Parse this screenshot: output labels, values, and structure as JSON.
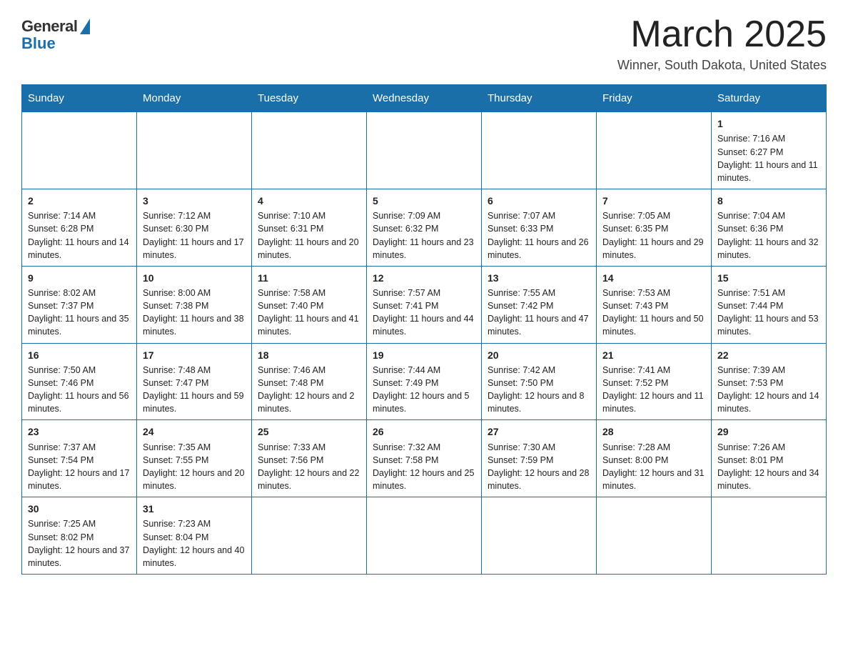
{
  "header": {
    "logo": {
      "general": "General",
      "blue": "Blue"
    },
    "title": "March 2025",
    "location": "Winner, South Dakota, United States"
  },
  "weekdays": [
    "Sunday",
    "Monday",
    "Tuesday",
    "Wednesday",
    "Thursday",
    "Friday",
    "Saturday"
  ],
  "weeks": [
    [
      {
        "day": "",
        "sunrise": "",
        "sunset": "",
        "daylight": ""
      },
      {
        "day": "",
        "sunrise": "",
        "sunset": "",
        "daylight": ""
      },
      {
        "day": "",
        "sunrise": "",
        "sunset": "",
        "daylight": ""
      },
      {
        "day": "",
        "sunrise": "",
        "sunset": "",
        "daylight": ""
      },
      {
        "day": "",
        "sunrise": "",
        "sunset": "",
        "daylight": ""
      },
      {
        "day": "",
        "sunrise": "",
        "sunset": "",
        "daylight": ""
      },
      {
        "day": "1",
        "sunrise": "Sunrise: 7:16 AM",
        "sunset": "Sunset: 6:27 PM",
        "daylight": "Daylight: 11 hours and 11 minutes."
      }
    ],
    [
      {
        "day": "2",
        "sunrise": "Sunrise: 7:14 AM",
        "sunset": "Sunset: 6:28 PM",
        "daylight": "Daylight: 11 hours and 14 minutes."
      },
      {
        "day": "3",
        "sunrise": "Sunrise: 7:12 AM",
        "sunset": "Sunset: 6:30 PM",
        "daylight": "Daylight: 11 hours and 17 minutes."
      },
      {
        "day": "4",
        "sunrise": "Sunrise: 7:10 AM",
        "sunset": "Sunset: 6:31 PM",
        "daylight": "Daylight: 11 hours and 20 minutes."
      },
      {
        "day": "5",
        "sunrise": "Sunrise: 7:09 AM",
        "sunset": "Sunset: 6:32 PM",
        "daylight": "Daylight: 11 hours and 23 minutes."
      },
      {
        "day": "6",
        "sunrise": "Sunrise: 7:07 AM",
        "sunset": "Sunset: 6:33 PM",
        "daylight": "Daylight: 11 hours and 26 minutes."
      },
      {
        "day": "7",
        "sunrise": "Sunrise: 7:05 AM",
        "sunset": "Sunset: 6:35 PM",
        "daylight": "Daylight: 11 hours and 29 minutes."
      },
      {
        "day": "8",
        "sunrise": "Sunrise: 7:04 AM",
        "sunset": "Sunset: 6:36 PM",
        "daylight": "Daylight: 11 hours and 32 minutes."
      }
    ],
    [
      {
        "day": "9",
        "sunrise": "Sunrise: 8:02 AM",
        "sunset": "Sunset: 7:37 PM",
        "daylight": "Daylight: 11 hours and 35 minutes."
      },
      {
        "day": "10",
        "sunrise": "Sunrise: 8:00 AM",
        "sunset": "Sunset: 7:38 PM",
        "daylight": "Daylight: 11 hours and 38 minutes."
      },
      {
        "day": "11",
        "sunrise": "Sunrise: 7:58 AM",
        "sunset": "Sunset: 7:40 PM",
        "daylight": "Daylight: 11 hours and 41 minutes."
      },
      {
        "day": "12",
        "sunrise": "Sunrise: 7:57 AM",
        "sunset": "Sunset: 7:41 PM",
        "daylight": "Daylight: 11 hours and 44 minutes."
      },
      {
        "day": "13",
        "sunrise": "Sunrise: 7:55 AM",
        "sunset": "Sunset: 7:42 PM",
        "daylight": "Daylight: 11 hours and 47 minutes."
      },
      {
        "day": "14",
        "sunrise": "Sunrise: 7:53 AM",
        "sunset": "Sunset: 7:43 PM",
        "daylight": "Daylight: 11 hours and 50 minutes."
      },
      {
        "day": "15",
        "sunrise": "Sunrise: 7:51 AM",
        "sunset": "Sunset: 7:44 PM",
        "daylight": "Daylight: 11 hours and 53 minutes."
      }
    ],
    [
      {
        "day": "16",
        "sunrise": "Sunrise: 7:50 AM",
        "sunset": "Sunset: 7:46 PM",
        "daylight": "Daylight: 11 hours and 56 minutes."
      },
      {
        "day": "17",
        "sunrise": "Sunrise: 7:48 AM",
        "sunset": "Sunset: 7:47 PM",
        "daylight": "Daylight: 11 hours and 59 minutes."
      },
      {
        "day": "18",
        "sunrise": "Sunrise: 7:46 AM",
        "sunset": "Sunset: 7:48 PM",
        "daylight": "Daylight: 12 hours and 2 minutes."
      },
      {
        "day": "19",
        "sunrise": "Sunrise: 7:44 AM",
        "sunset": "Sunset: 7:49 PM",
        "daylight": "Daylight: 12 hours and 5 minutes."
      },
      {
        "day": "20",
        "sunrise": "Sunrise: 7:42 AM",
        "sunset": "Sunset: 7:50 PM",
        "daylight": "Daylight: 12 hours and 8 minutes."
      },
      {
        "day": "21",
        "sunrise": "Sunrise: 7:41 AM",
        "sunset": "Sunset: 7:52 PM",
        "daylight": "Daylight: 12 hours and 11 minutes."
      },
      {
        "day": "22",
        "sunrise": "Sunrise: 7:39 AM",
        "sunset": "Sunset: 7:53 PM",
        "daylight": "Daylight: 12 hours and 14 minutes."
      }
    ],
    [
      {
        "day": "23",
        "sunrise": "Sunrise: 7:37 AM",
        "sunset": "Sunset: 7:54 PM",
        "daylight": "Daylight: 12 hours and 17 minutes."
      },
      {
        "day": "24",
        "sunrise": "Sunrise: 7:35 AM",
        "sunset": "Sunset: 7:55 PM",
        "daylight": "Daylight: 12 hours and 20 minutes."
      },
      {
        "day": "25",
        "sunrise": "Sunrise: 7:33 AM",
        "sunset": "Sunset: 7:56 PM",
        "daylight": "Daylight: 12 hours and 22 minutes."
      },
      {
        "day": "26",
        "sunrise": "Sunrise: 7:32 AM",
        "sunset": "Sunset: 7:58 PM",
        "daylight": "Daylight: 12 hours and 25 minutes."
      },
      {
        "day": "27",
        "sunrise": "Sunrise: 7:30 AM",
        "sunset": "Sunset: 7:59 PM",
        "daylight": "Daylight: 12 hours and 28 minutes."
      },
      {
        "day": "28",
        "sunrise": "Sunrise: 7:28 AM",
        "sunset": "Sunset: 8:00 PM",
        "daylight": "Daylight: 12 hours and 31 minutes."
      },
      {
        "day": "29",
        "sunrise": "Sunrise: 7:26 AM",
        "sunset": "Sunset: 8:01 PM",
        "daylight": "Daylight: 12 hours and 34 minutes."
      }
    ],
    [
      {
        "day": "30",
        "sunrise": "Sunrise: 7:25 AM",
        "sunset": "Sunset: 8:02 PM",
        "daylight": "Daylight: 12 hours and 37 minutes."
      },
      {
        "day": "31",
        "sunrise": "Sunrise: 7:23 AM",
        "sunset": "Sunset: 8:04 PM",
        "daylight": "Daylight: 12 hours and 40 minutes."
      },
      {
        "day": "",
        "sunrise": "",
        "sunset": "",
        "daylight": ""
      },
      {
        "day": "",
        "sunrise": "",
        "sunset": "",
        "daylight": ""
      },
      {
        "day": "",
        "sunrise": "",
        "sunset": "",
        "daylight": ""
      },
      {
        "day": "",
        "sunrise": "",
        "sunset": "",
        "daylight": ""
      },
      {
        "day": "",
        "sunrise": "",
        "sunset": "",
        "daylight": ""
      }
    ]
  ]
}
